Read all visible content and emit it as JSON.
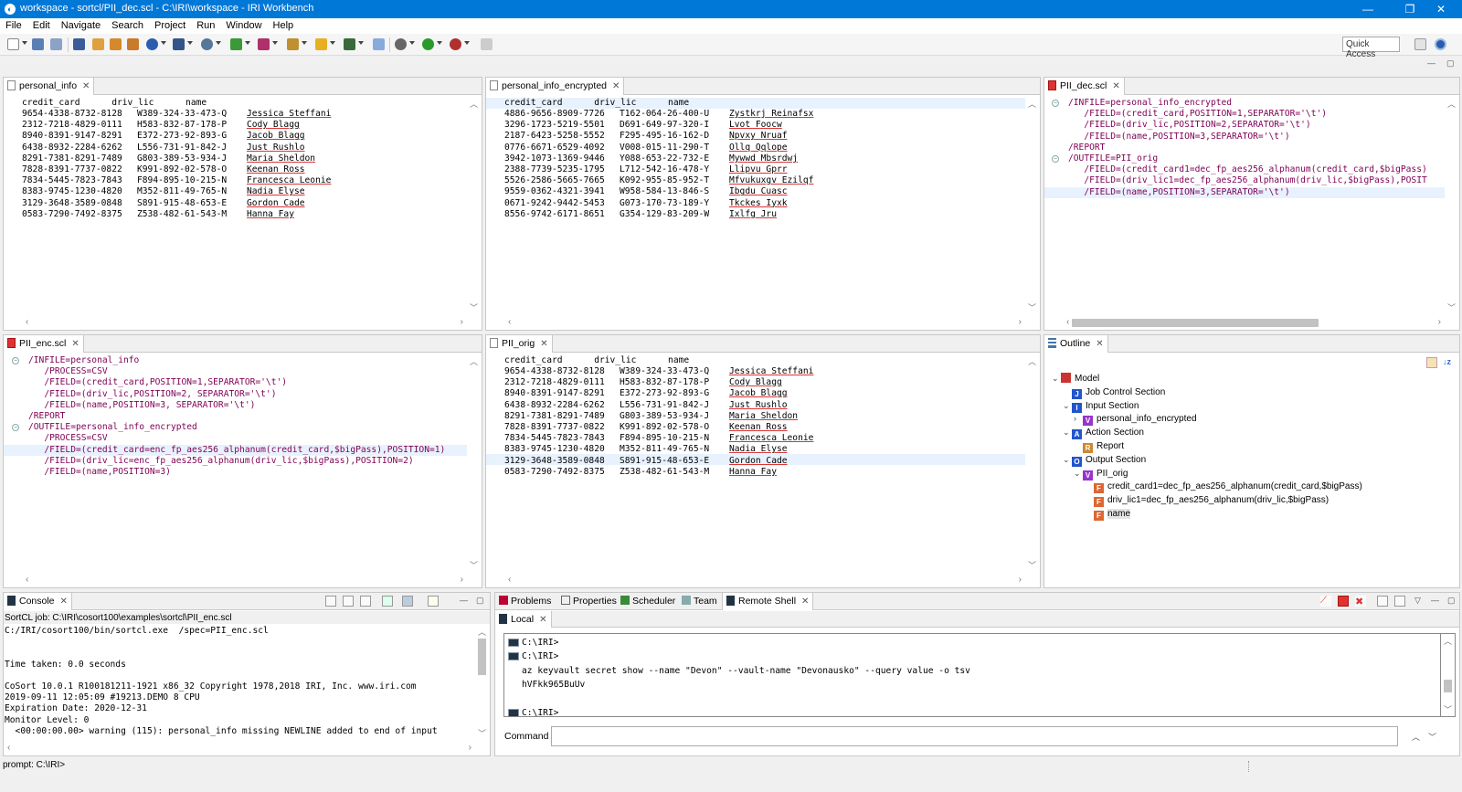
{
  "window": {
    "title": "workspace - sortcl/PII_dec.scl - C:\\IRI\\workspace - IRI Workbench",
    "app_icon": "eclipse-icon"
  },
  "menu": [
    "File",
    "Edit",
    "Navigate",
    "Search",
    "Project",
    "Run",
    "Window",
    "Help"
  ],
  "toolbar": {
    "quick_access": "Quick Access"
  },
  "personal_info": {
    "tab": "personal_info",
    "header": "credit_card      driv_lic      name",
    "rows": [
      [
        "9654-4338-8732-8128",
        "W389-324-33-473-Q",
        "Jessica Steffani"
      ],
      [
        "2312-7218-4829-0111",
        "H583-832-87-178-P",
        "Cody Blagg"
      ],
      [
        "8940-8391-9147-8291",
        "E372-273-92-893-G",
        "Jacob Blagg"
      ],
      [
        "6438-8932-2284-6262",
        "L556-731-91-842-J",
        "Just Rushlo"
      ],
      [
        "8291-7381-8291-7489",
        "G803-389-53-934-J",
        "Maria Sheldon"
      ],
      [
        "7828-8391-7737-0822",
        "K991-892-02-578-O",
        "Keenan Ross"
      ],
      [
        "7834-5445-7823-7843",
        "F894-895-10-215-N",
        "Francesca Leonie"
      ],
      [
        "8383-9745-1230-4820",
        "M352-811-49-765-N",
        "Nadia Elyse"
      ],
      [
        "3129-3648-3589-0848",
        "S891-915-48-653-E",
        "Gordon Cade"
      ],
      [
        "0583-7290-7492-8375",
        "Z538-482-61-543-M",
        "Hanna Fay"
      ]
    ]
  },
  "personal_info_encrypted": {
    "tab": "personal_info_encrypted",
    "header": "credit_card      driv_lic      name",
    "rows": [
      [
        "4886-9656-8909-7726",
        "T162-064-26-400-U",
        "Zystkrj Reinafsx"
      ],
      [
        "3296-1723-5219-5501",
        "D691-649-97-320-I",
        "Lvot Foocw"
      ],
      [
        "2187-6423-5258-5552",
        "F295-495-16-162-D",
        "Npvxy Nruaf"
      ],
      [
        "0776-6671-6529-4092",
        "V008-015-11-290-T",
        "Ollq Qqlope"
      ],
      [
        "3942-1073-1369-9446",
        "Y088-653-22-732-E",
        "Mywwd Mbsrdwj"
      ],
      [
        "2388-7739-5235-1795",
        "L712-542-16-478-Y",
        "Llipvu Gprr"
      ],
      [
        "5526-2586-5665-7665",
        "K092-955-85-952-T",
        "Mfvukuxgv Ezilqf"
      ],
      [
        "9559-0362-4321-3941",
        "W958-584-13-846-S",
        "Ibgdu Cuasc"
      ],
      [
        "0671-9242-9442-5453",
        "G073-170-73-189-Y",
        "Tkckes Iyxk"
      ],
      [
        "8556-9742-6171-8651",
        "G354-129-83-209-W",
        "Ixlfg Jru"
      ]
    ]
  },
  "pii_dec": {
    "tab": "PII_dec.scl",
    "lines": [
      "/INFILE=personal_info_encrypted",
      "   /FIELD=(credit_card,POSITION=1,SEPARATOR='\\t')",
      "   /FIELD=(driv_lic,POSITION=2,SEPARATOR='\\t')",
      "   /FIELD=(name,POSITION=3,SEPARATOR='\\t')",
      "/REPORT",
      "/OUTFILE=PII_orig",
      "   /FIELD=(credit_card1=dec_fp_aes256_alphanum(credit_card,$bigPass)",
      "   /FIELD=(driv_lic1=dec_fp_aes256_alphanum(driv_lic,$bigPass),POSIT",
      "   /FIELD=(name,POSITION=3,SEPARATOR='\\t')"
    ]
  },
  "pii_enc": {
    "tab": "PII_enc.scl",
    "lines": [
      "/INFILE=personal_info",
      "   /PROCESS=CSV",
      "   /FIELD=(credit_card,POSITION=1,SEPARATOR='\\t')",
      "   /FIELD=(driv_lic,POSITION=2, SEPARATOR='\\t')",
      "   /FIELD=(name,POSITION=3, SEPARATOR='\\t')",
      "/REPORT",
      "/OUTFILE=personal_info_encrypted",
      "   /PROCESS=CSV",
      "   /FIELD=(credit_card=enc_fp_aes256_alphanum(credit_card,$bigPass),POSITION=1)",
      "   /FIELD=(driv_lic=enc_fp_aes256_alphanum(driv_lic,$bigPass),POSITION=2)",
      "   /FIELD=(name,POSITION=3)"
    ]
  },
  "pii_orig": {
    "tab": "PII_orig",
    "header": "credit_card      driv_lic      name",
    "rows": [
      [
        "9654-4338-8732-8128",
        "W389-324-33-473-Q",
        "Jessica Steffani"
      ],
      [
        "2312-7218-4829-0111",
        "H583-832-87-178-P",
        "Cody Blagg"
      ],
      [
        "8940-8391-9147-8291",
        "E372-273-92-893-G",
        "Jacob Blagg"
      ],
      [
        "6438-8932-2284-6262",
        "L556-731-91-842-J",
        "Just Rushlo"
      ],
      [
        "8291-7381-8291-7489",
        "G803-389-53-934-J",
        "Maria Sheldon"
      ],
      [
        "7828-8391-7737-0822",
        "K991-892-02-578-O",
        "Keenan Ross"
      ],
      [
        "7834-5445-7823-7843",
        "F894-895-10-215-N",
        "Francesca Leonie"
      ],
      [
        "8383-9745-1230-4820",
        "M352-811-49-765-N",
        "Nadia Elyse"
      ],
      [
        "3129-3648-3589-0848",
        "S891-915-48-653-E",
        "Gordon Cade"
      ],
      [
        "0583-7290-7492-8375",
        "Z538-482-61-543-M",
        "Hanna Fay"
      ]
    ]
  },
  "outline": {
    "tab": "Outline",
    "items": [
      {
        "label": "Model",
        "depth": 0,
        "twisty": "⌄",
        "icon": "file-red",
        "color": "#c33"
      },
      {
        "label": "Job Control Section",
        "depth": 1,
        "twisty": "",
        "icon": "J",
        "color": "#2255cc"
      },
      {
        "label": "Input Section",
        "depth": 1,
        "twisty": "⌄",
        "icon": "I",
        "color": "#2255cc"
      },
      {
        "label": "personal_info_encrypted",
        "depth": 2,
        "twisty": "›",
        "icon": "V",
        "color": "#9933cc"
      },
      {
        "label": "Action Section",
        "depth": 1,
        "twisty": "⌄",
        "icon": "A",
        "color": "#2255cc"
      },
      {
        "label": "Report",
        "depth": 2,
        "twisty": "",
        "icon": "R",
        "color": "#cc8833"
      },
      {
        "label": "Output Section",
        "depth": 1,
        "twisty": "⌄",
        "icon": "O",
        "color": "#2255cc"
      },
      {
        "label": "PII_orig",
        "depth": 2,
        "twisty": "⌄",
        "icon": "V",
        "color": "#9933cc"
      },
      {
        "label": "credit_card1=dec_fp_aes256_alphanum(credit_card,$bigPass)",
        "depth": 3,
        "twisty": "",
        "icon": "F",
        "color": "#dd6633"
      },
      {
        "label": "driv_lic1=dec_fp_aes256_alphanum(driv_lic,$bigPass)",
        "depth": 3,
        "twisty": "",
        "icon": "F",
        "color": "#dd6633"
      },
      {
        "label": "name",
        "depth": 3,
        "twisty": "",
        "icon": "F",
        "color": "#dd6633"
      }
    ]
  },
  "console": {
    "tab": "Console",
    "job": "SortCL job: C:\\IRI\\cosort100\\examples\\sortcl\\PII_enc.scl",
    "lines": [
      "C:/IRI/cosort100/bin/sortcl.exe  /spec=PII_enc.scl",
      "",
      "",
      "Time taken: 0.0 seconds",
      "",
      "CoSort 10.0.1 R100181211-1921 x86_32 Copyright 1978,2018 IRI, Inc. www.iri.com",
      "2019-09-11 12:05:09 #19213.DEMO 8 CPU",
      "Expiration Date: 2020-12-31",
      "Monitor Level: 0",
      "  <00:00:00.00> warning (115): personal_info missing NEWLINE added to end of input"
    ]
  },
  "bottom_tabs": [
    "Problems",
    "Properties",
    "Scheduler",
    "Team",
    "Remote Shell"
  ],
  "remote_shell": {
    "subtab": "Local",
    "lines": [
      {
        "prompt": "C:\\IRI>",
        "text": ""
      },
      {
        "prompt": "C:\\IRI>",
        "text": ""
      },
      {
        "prompt": "",
        "text": "az keyvault secret show --name \"Devon\" --vault-name \"Devonausko\" --query value -o tsv"
      },
      {
        "prompt": "",
        "text": "hVFkk965BuUv"
      },
      {
        "prompt": "",
        "text": ""
      },
      {
        "prompt": "C:\\IRI>",
        "text": ""
      }
    ],
    "command_label": "Command",
    "command_value": ""
  },
  "status": {
    "prompt": "prompt: C:\\IRI>"
  }
}
